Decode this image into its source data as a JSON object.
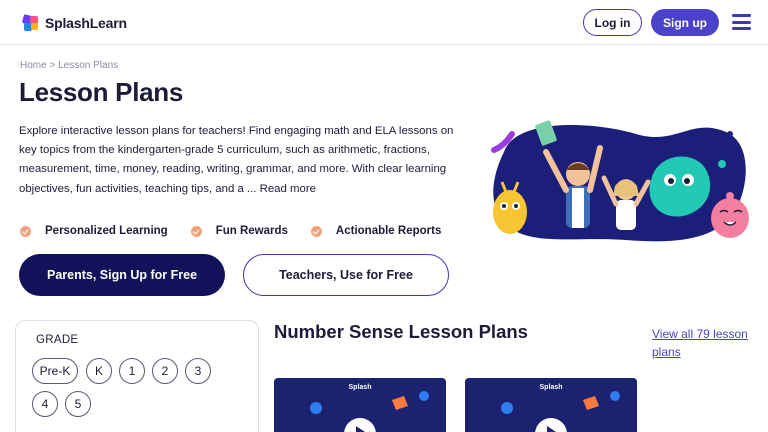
{
  "header": {
    "logo_text": "SplashLearn",
    "login_label": "Log in",
    "signup_label": "Sign up",
    "menu_icon": "hamburger-menu-icon"
  },
  "breadcrumb": {
    "home": "Home",
    "separator": ">",
    "current": "Lesson Plans"
  },
  "hero": {
    "title": "Lesson Plans",
    "intro": "Explore interactive lesson plans for teachers! Find engaging math and ELA lessons on key topics from the kindergarten-grade 5 curriculum, such as arithmetic, fractions, measurement, time, money, reading, writing, grammar, and more. With clear learning objectives, fun activities, teaching tips, and a ... Read more",
    "features": [
      "Personalized Learning",
      "Fun Rewards",
      "Actionable Reports"
    ],
    "cta_parents": "Parents, Sign Up for Free",
    "cta_teachers": "Teachers, Use for Free"
  },
  "filters": {
    "grade_title": "GRADE",
    "grades": [
      "Pre-K",
      "K",
      "1",
      "2",
      "3",
      "4",
      "5"
    ]
  },
  "content": {
    "section_title": "Number Sense Lesson Plans",
    "view_all": "View all 79 lesson plans",
    "card_brand": "Splash"
  },
  "colors": {
    "brand_dark": "#12125a",
    "accent": "#4a42c8",
    "check": "#f0a37a"
  }
}
